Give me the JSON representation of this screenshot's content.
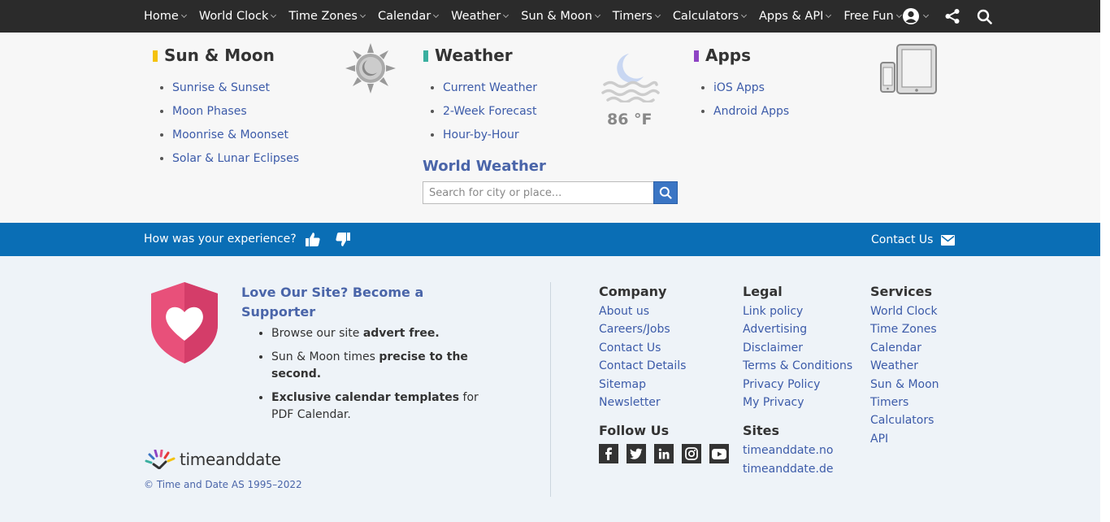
{
  "nav": {
    "items": [
      "Home",
      "World Clock",
      "Time Zones",
      "Calendar",
      "Weather",
      "Sun & Moon",
      "Timers",
      "Calculators",
      "Apps & API",
      "Free Fun"
    ]
  },
  "menu": {
    "sun_moon": {
      "title": "Sun & Moon",
      "links": [
        "Sunrise & Sunset",
        "Moon Phases",
        "Moonrise & Moonset",
        "Solar & Lunar Eclipses"
      ]
    },
    "weather": {
      "title": "Weather",
      "links": [
        "Current Weather",
        "2-Week Forecast",
        "Hour-by-Hour"
      ],
      "temperature": "86 °F"
    },
    "apps": {
      "title": "Apps",
      "links": [
        "iOS Apps",
        "Android Apps"
      ]
    },
    "world_weather": {
      "title": "World Weather",
      "placeholder": "Search for city or place..."
    }
  },
  "feedback": {
    "question": "How was your experience?",
    "contact": "Contact Us"
  },
  "supporter": {
    "title": "Love Our Site? Become a Supporter",
    "benefits": [
      {
        "pre": "Browse our site ",
        "bold": "advert free.",
        "post": ""
      },
      {
        "pre": "Sun & Moon times ",
        "bold": "precise to the second.",
        "post": ""
      },
      {
        "pre": "",
        "bold": "Exclusive calendar templates",
        "post": " for PDF Calendar."
      }
    ]
  },
  "footer": {
    "company": {
      "title": "Company",
      "links": [
        "About us",
        "Careers/Jobs",
        "Contact Us",
        "Contact Details",
        "Sitemap",
        "Newsletter"
      ]
    },
    "legal": {
      "title": "Legal",
      "links": [
        "Link policy",
        "Advertising",
        "Disclaimer",
        "Terms & Conditions",
        "Privacy Policy",
        "My Privacy"
      ]
    },
    "services": {
      "title": "Services",
      "links": [
        "World Clock",
        "Time Zones",
        "Calendar",
        "Weather",
        "Sun & Moon",
        "Timers",
        "Calculators",
        "API"
      ]
    },
    "follow": {
      "title": "Follow Us",
      "networks": [
        "facebook-icon",
        "twitter-icon",
        "linkedin-icon",
        "instagram-icon",
        "youtube-icon"
      ]
    },
    "sites": {
      "title": "Sites",
      "links": [
        "timeanddate.no",
        "timeanddate.de"
      ]
    },
    "brand": "timeanddate",
    "copyright": "© Time and Date AS 1995–2022"
  },
  "colors": {
    "nav_bg": "#2b2b2b",
    "feedback_bg": "#0a6eb5",
    "link": "#3c5ba9",
    "sun_moon_accent": "#f4c20d",
    "weather_accent": "#3aaf9f",
    "apps_accent": "#8e44c4",
    "heart_shield": "#e8507a"
  }
}
